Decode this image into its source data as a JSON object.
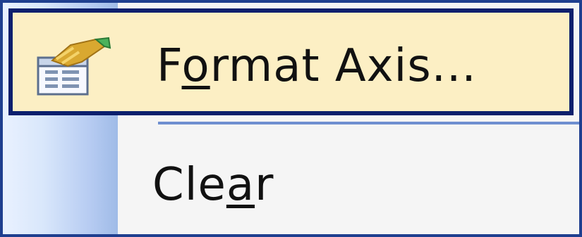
{
  "menu": {
    "items": [
      {
        "label_before": "F",
        "label_mnemonic": "o",
        "label_after": "rmat Axis...",
        "state": "highlighted",
        "icon": "format-axis-icon"
      },
      {
        "label_before": "Cle",
        "label_mnemonic": "a",
        "label_after": "r",
        "state": "normal",
        "icon": null
      }
    ]
  },
  "colors": {
    "highlight_fill": "#fcefc4",
    "highlight_border": "#0b1f6d",
    "menu_border": "#1f3f8f",
    "separator": "#6f8fd0"
  }
}
